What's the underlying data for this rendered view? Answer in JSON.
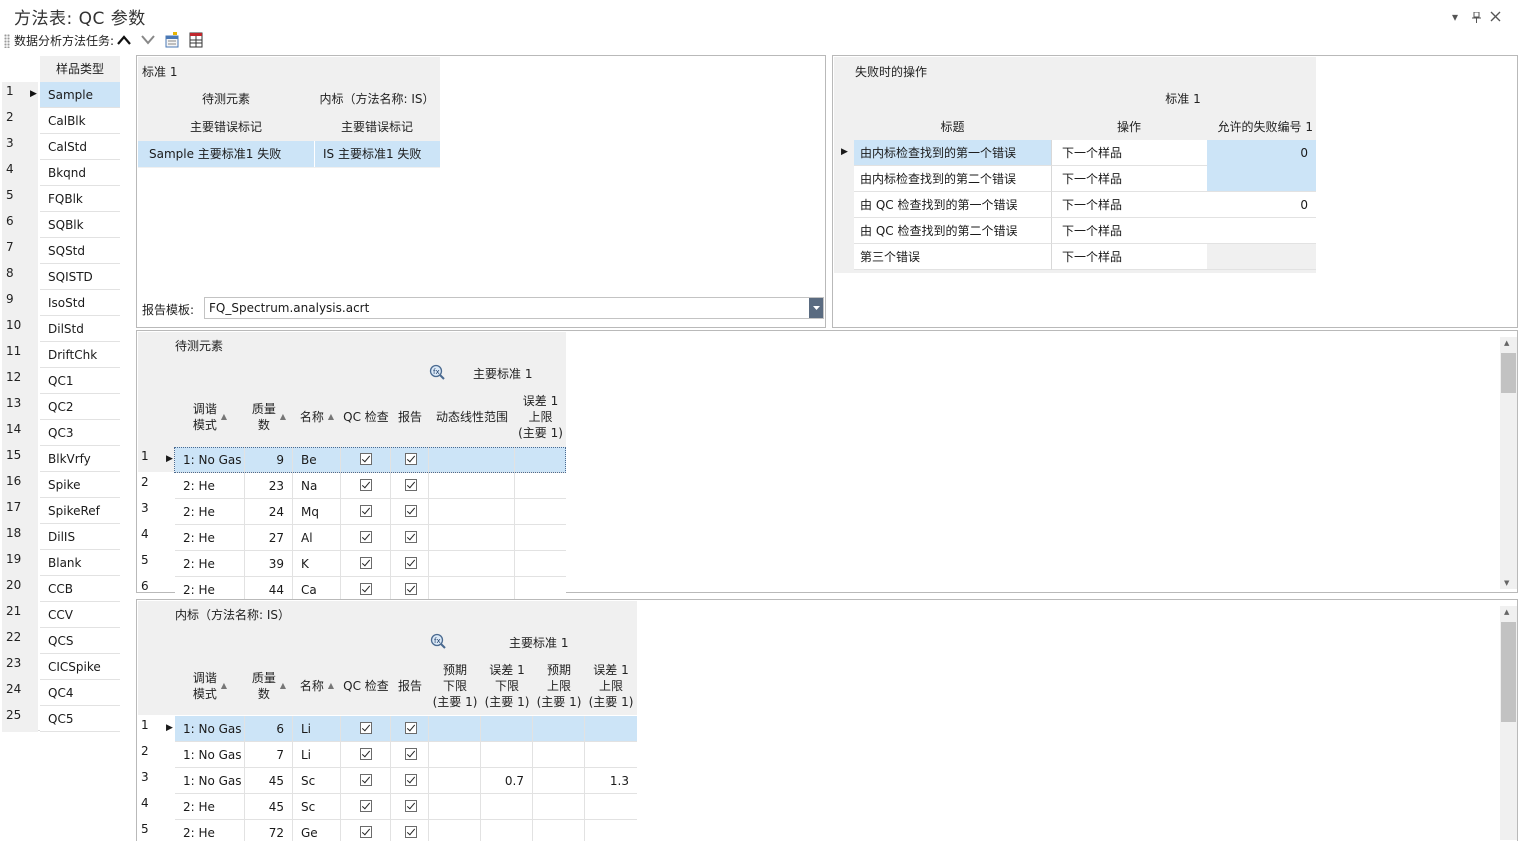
{
  "window": {
    "title": "方法表: QC 参数",
    "controls": {
      "dropdown": "▾",
      "pin": "📌",
      "close": "✕"
    }
  },
  "toolbar": {
    "label": "数据分析方法任务:"
  },
  "sample_types": {
    "header": "样品类型",
    "items": [
      "Sample",
      "CalBlk",
      "CalStd",
      "Bkqnd",
      "FQBlk",
      "SQBlk",
      "SQStd",
      "SQISTD",
      "IsoStd",
      "DilStd",
      "DriftChk",
      "QC1",
      "QC2",
      "QC3",
      "BlkVrfy",
      "Spike",
      "SpikeRef",
      "DilIS",
      "Blank",
      "CCB",
      "CCV",
      "QCS",
      "CICSpike",
      "QC4",
      "QC5"
    ]
  },
  "standard_panel": {
    "title": "标准 1",
    "col_headers": [
      "待测元素",
      "内标（方法名称: IS）"
    ],
    "sub_headers": [
      "主要错误标记",
      "主要错误标记"
    ],
    "row": [
      "Sample 主要标准1 失败",
      "IS 主要标准1 失败"
    ],
    "report_label": "报告模板:",
    "report_value": "FQ_Spectrum.analysis.acrt"
  },
  "failure_panel": {
    "title": "失败时的操作",
    "group_header": "标准 1",
    "headers": [
      "标题",
      "操作",
      "允许的失败编号 1"
    ],
    "rows": [
      {
        "title": "由内标检查找到的第一个错误",
        "action": "下一个样品",
        "count": "0"
      },
      {
        "title": "由内标检查找到的第二个错误",
        "action": "下一个样品",
        "count": ""
      },
      {
        "title": "由 QC 检查找到的第一个错误",
        "action": "下一个样品",
        "count": "0"
      },
      {
        "title": "由 QC 检查找到的第二个错误",
        "action": "下一个样品",
        "count": ""
      },
      {
        "title": "第三个错误",
        "action": "下一个样品",
        "count": ""
      }
    ]
  },
  "analyte_panel": {
    "title": "待测元素",
    "group_header": "主要标准 1",
    "headers": {
      "tune": "调谐\n模式",
      "mass": "质量\n数",
      "name": "名称",
      "qc": "QC 检查",
      "report": "报告",
      "range": "动态线性范围",
      "err_upper": "误差 1\n上限\n(主要 1)"
    },
    "rows": [
      {
        "n": "1",
        "tune": "1: No Gas",
        "mass": "9",
        "name": "Be"
      },
      {
        "n": "2",
        "tune": "2: He",
        "mass": "23",
        "name": "Na"
      },
      {
        "n": "3",
        "tune": "2: He",
        "mass": "24",
        "name": "Mq"
      },
      {
        "n": "4",
        "tune": "2: He",
        "mass": "27",
        "name": "Al"
      },
      {
        "n": "5",
        "tune": "2: He",
        "mass": "39",
        "name": "K"
      },
      {
        "n": "6",
        "tune": "2: He",
        "mass": "44",
        "name": "Ca"
      }
    ]
  },
  "istd_panel": {
    "title": "内标（方法名称: IS）",
    "group_header": "主要标准 1",
    "headers": {
      "tune": "调谐\n模式",
      "mass": "质量\n数",
      "name": "名称",
      "qc": "QC 检查",
      "report": "报告",
      "exp_lower": "预期\n下限\n(主要 1)",
      "err_lower": "误差 1\n下限\n(主要 1)",
      "exp_upper": "预期\n上限\n(主要 1)",
      "err_upper": "误差 1\n上限\n(主要 1)"
    },
    "rows": [
      {
        "n": "1",
        "tune": "1: No Gas",
        "mass": "6",
        "name": "Li",
        "el": "",
        "eu": ""
      },
      {
        "n": "2",
        "tune": "1: No Gas",
        "mass": "7",
        "name": "Li",
        "el": "",
        "eu": ""
      },
      {
        "n": "3",
        "tune": "1: No Gas",
        "mass": "45",
        "name": "Sc",
        "el": "0.7",
        "eu": "1.3"
      },
      {
        "n": "4",
        "tune": "2: He",
        "mass": "45",
        "name": "Sc",
        "el": "",
        "eu": ""
      },
      {
        "n": "5",
        "tune": "2: He",
        "mass": "72",
        "name": "Ge",
        "el": "",
        "eu": ""
      }
    ]
  }
}
